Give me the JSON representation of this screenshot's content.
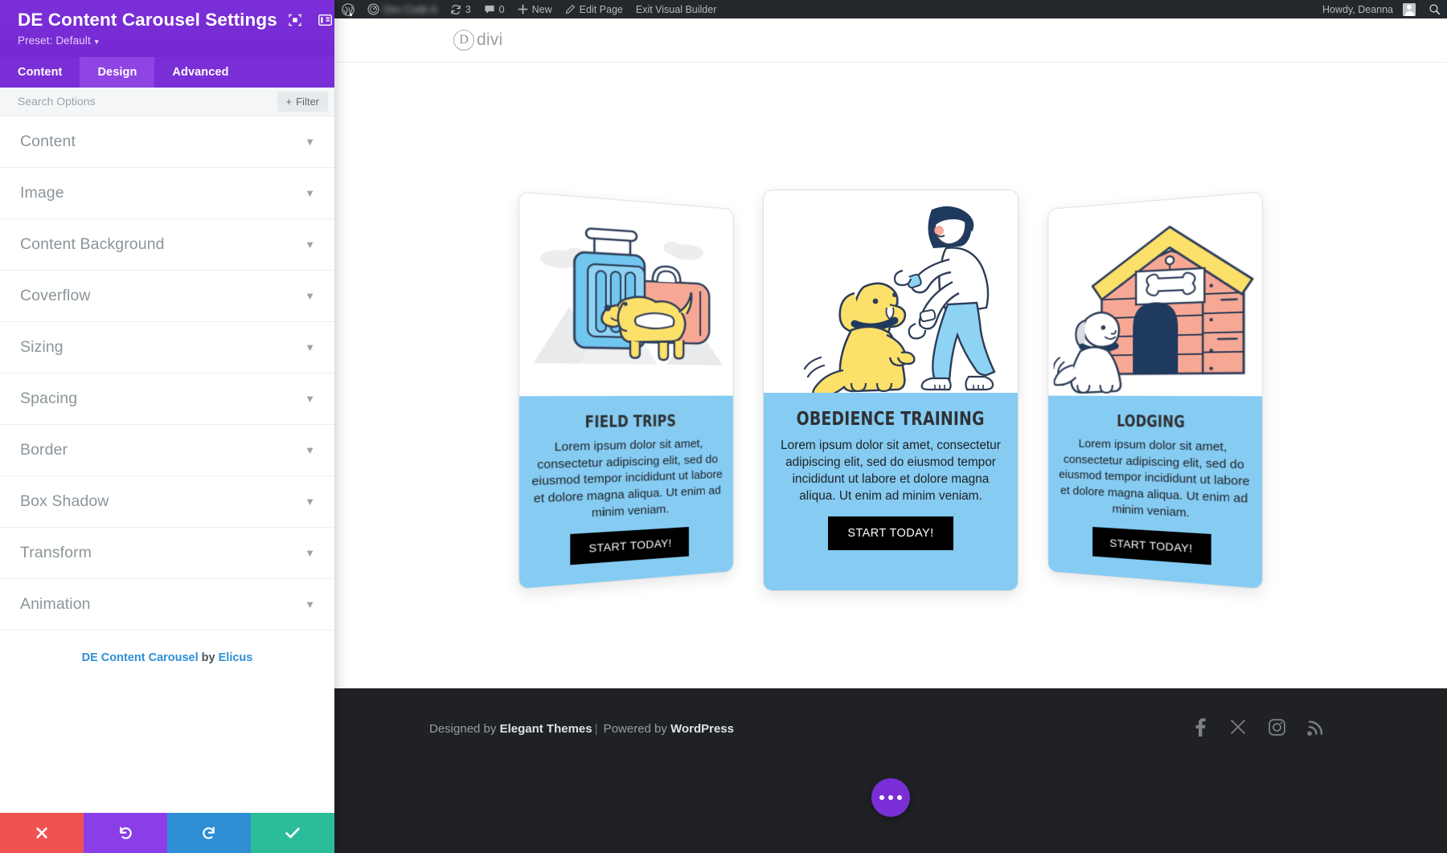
{
  "settings_panel": {
    "title": "DE Content Carousel Settings",
    "preset_label": "Preset: Default",
    "header_icons": [
      "focus-target-icon",
      "layout-panel-icon",
      "vertical-dots-icon"
    ],
    "tabs": [
      {
        "label": "Content",
        "active": false
      },
      {
        "label": "Design",
        "active": true
      },
      {
        "label": "Advanced",
        "active": false
      }
    ],
    "search": {
      "value": "",
      "placeholder": "Search Options"
    },
    "filter_label": "Filter",
    "sections": [
      {
        "label": "Content"
      },
      {
        "label": "Image"
      },
      {
        "label": "Content Background"
      },
      {
        "label": "Coverflow"
      },
      {
        "label": "Sizing"
      },
      {
        "label": "Spacing"
      },
      {
        "label": "Border"
      },
      {
        "label": "Box Shadow"
      },
      {
        "label": "Transform"
      },
      {
        "label": "Animation"
      }
    ],
    "credit": {
      "module_name": "DE Content Carousel",
      "by": " by ",
      "author": "Elicus"
    },
    "footer_buttons": [
      {
        "name": "cancel",
        "icon": "close-icon",
        "color": "#ef5350"
      },
      {
        "name": "undo",
        "icon": "undo-icon",
        "color": "#8b3ee8"
      },
      {
        "name": "redo",
        "icon": "redo-icon",
        "color": "#2e8fd4"
      },
      {
        "name": "save",
        "icon": "check-icon",
        "color": "#2bbd9a"
      }
    ]
  },
  "admin_bar": {
    "wp_logo": "wordpress-icon",
    "site_name": "",
    "updates_count": "3",
    "comments_count": "0",
    "new_label": "New",
    "edit_page_label": "Edit Page",
    "exit_builder_label": "Exit Visual Builder",
    "howdy": "Howdy, Deanna",
    "search_icon": "search-icon"
  },
  "site": {
    "logo_letter": "D",
    "logo_word": "divi"
  },
  "carousel": {
    "cards": [
      {
        "position": "left",
        "illustration": "dog-with-luggage-illustration",
        "title": "FIELD TRIPS",
        "text": "Lorem ipsum dolor sit amet, consectetur adipiscing elit, sed do eiusmod tempor incididunt ut labore et dolore magna aliqua. Ut enim ad minim veniam.",
        "cta": "START TODAY!"
      },
      {
        "position": "center",
        "illustration": "person-training-dog-illustration",
        "title": "OBEDIENCE TRAINING",
        "text": "Lorem ipsum dolor sit amet, consectetur adipiscing elit, sed do eiusmod tempor incididunt ut labore et dolore magna aliqua. Ut enim ad minim veniam.",
        "cta": "START TODAY!"
      },
      {
        "position": "right",
        "illustration": "dog-house-illustration",
        "title": "LODGING",
        "text": "Lorem ipsum dolor sit amet, consectetur adipiscing elit, sed do eiusmod tempor incididunt ut labore et dolore magna aliqua. Ut enim ad minim veniam.",
        "cta": "START TODAY!"
      }
    ]
  },
  "footer": {
    "designed_by": "Designed by ",
    "designer": "Elegant Themes",
    "separator": "|",
    "powered_by": " Powered by ",
    "platform": "WordPress",
    "social": [
      "facebook-icon",
      "x-twitter-icon",
      "instagram-icon",
      "rss-icon"
    ]
  },
  "colors": {
    "brand_purple": "#7a2ed6",
    "tab_active_purple": "#8f44e4",
    "card_blue": "#85cbf2",
    "admin_bar": "#23282d",
    "footer_dark": "#1f2124",
    "link_blue": "#2e8fd4"
  }
}
